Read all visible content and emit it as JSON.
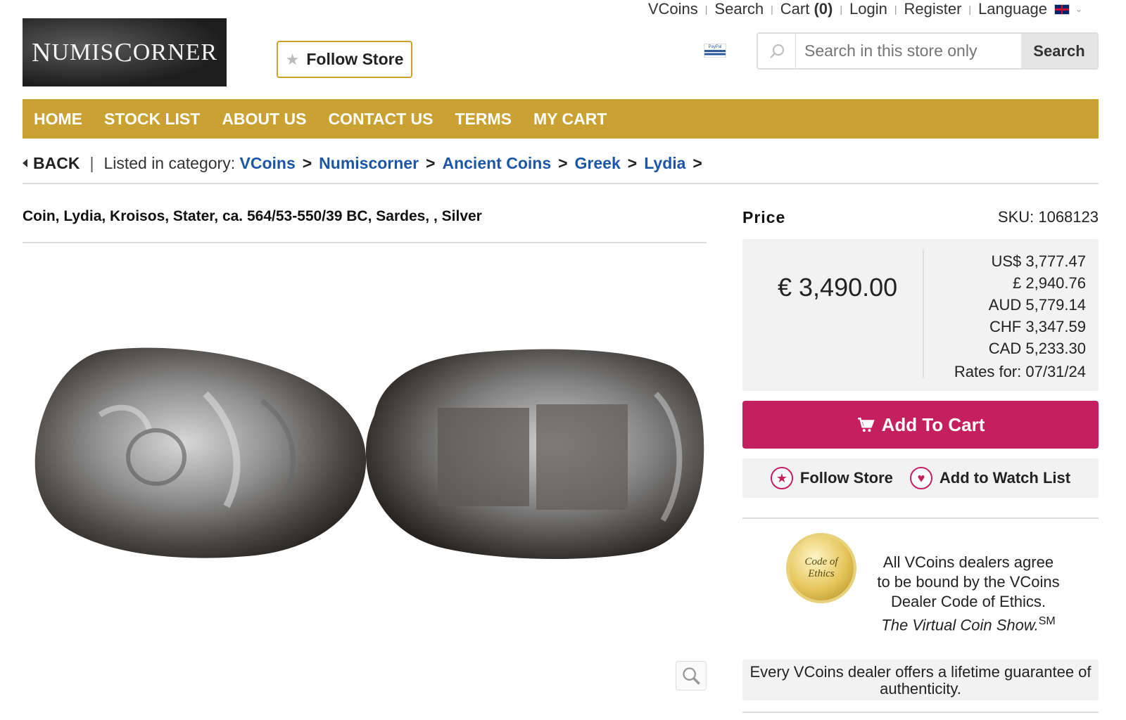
{
  "topbar": {
    "links": [
      "VCoins",
      "Search",
      "Cart",
      "Login",
      "Register",
      "Language"
    ],
    "cart_count": "(0)"
  },
  "logo": {
    "text_a": "N",
    "text_b": "UMIS",
    "text_c": "C",
    "text_d": "ORNER"
  },
  "header": {
    "follow_label": "Follow Store",
    "paypal_label": "PayPal",
    "search_placeholder": "Search in this store only",
    "search_button": "Search"
  },
  "nav": {
    "items": [
      "HOME",
      "STOCK LIST",
      "ABOUT US",
      "CONTACT US",
      "TERMS",
      "MY CART"
    ]
  },
  "breadcrumb": {
    "back": "BACK",
    "pipe": "|",
    "prefix": "Listed in category:",
    "items": [
      "VCoins",
      "Numiscorner",
      "Ancient Coins",
      "Greek",
      "Lydia"
    ],
    "sep": ">"
  },
  "product": {
    "title": "Coin, Lydia, Kroisos, Stater, ca. 564/53-550/39 BC, Sardes, , Silver"
  },
  "price": {
    "label": "Price",
    "sku": "SKU: 1068123",
    "main": "€ 3,490.00",
    "rates": [
      "US$ 3,777.47",
      "£ 2,940.76",
      "AUD 5,779.14",
      "CHF 3,347.59",
      "CAD 5,233.30",
      "Rates for: 07/31/24"
    ]
  },
  "actions": {
    "add_to_cart": "Add To Cart",
    "follow_store": "Follow Store",
    "watch_list": "Add to Watch List"
  },
  "ethics": {
    "seal_line1": "Code of",
    "seal_line2": "Ethics",
    "text": "All VCoins dealers agree to be bound by the VCoins Dealer Code of Ethics.",
    "italic": "The Virtual Coin Show.",
    "sup": "SM",
    "guarantee": "Every VCoins dealer offers a lifetime guarantee of authenticity."
  },
  "colors": {
    "accent": "#caa234",
    "cart": "#c4205f",
    "link": "#1e56a6"
  }
}
